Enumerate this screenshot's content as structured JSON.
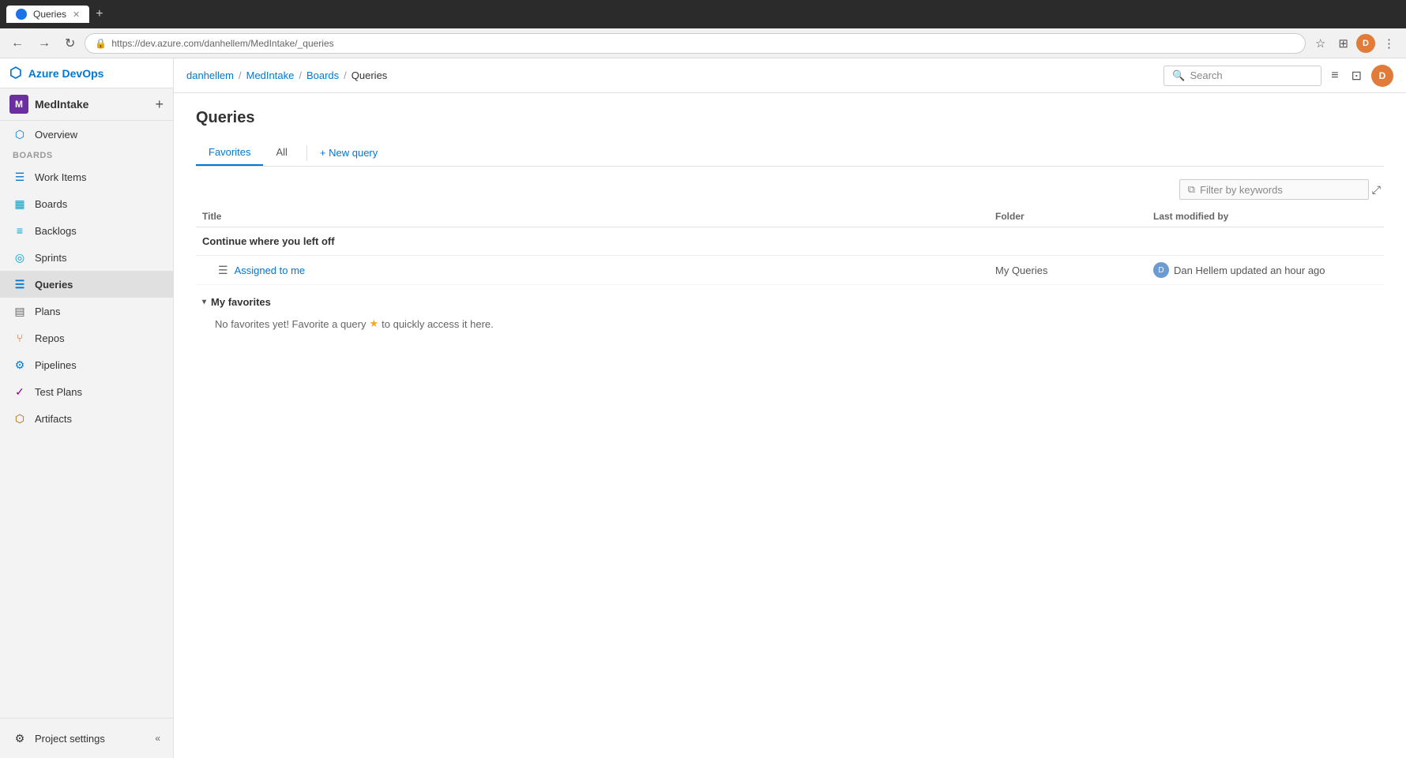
{
  "browser": {
    "tab_title": "Queries",
    "tab_favicon": "Q",
    "url": "https://dev.azure.com/danhellem/MedIntake/_queries",
    "back_btn": "←",
    "forward_btn": "→",
    "refresh_btn": "↻",
    "bookmark_icon": "☆",
    "profile_initial": "D",
    "extensions_icon": "⊞",
    "menu_icon": "⋮"
  },
  "topbar": {
    "breadcrumb": [
      {
        "label": "danhellem",
        "href": "#"
      },
      {
        "label": "MedIntake",
        "href": "#"
      },
      {
        "label": "Boards",
        "href": "#"
      },
      {
        "label": "Queries",
        "href": "#",
        "current": true
      }
    ],
    "search_placeholder": "Search",
    "settings_icon": "≡",
    "marketplace_icon": "⊡",
    "user_initial": "D"
  },
  "app_header": {
    "logo_icon": "◈",
    "logo_text": "Azure DevOps"
  },
  "project": {
    "avatar_initial": "M",
    "name": "MedIntake",
    "add_icon": "+"
  },
  "sidebar": {
    "nav_items": [
      {
        "id": "overview",
        "label": "Overview",
        "icon": "⬡"
      },
      {
        "id": "boards",
        "label": "Boards",
        "icon": "▦"
      },
      {
        "id": "work-items",
        "label": "Work Items",
        "icon": "☰"
      },
      {
        "id": "boards-sub",
        "label": "Boards",
        "icon": "▦"
      },
      {
        "id": "backlogs",
        "label": "Backlogs",
        "icon": "≡"
      },
      {
        "id": "sprints",
        "label": "Sprints",
        "icon": "◎"
      },
      {
        "id": "queries",
        "label": "Queries",
        "icon": "☰",
        "active": true
      },
      {
        "id": "plans",
        "label": "Plans",
        "icon": "▤"
      },
      {
        "id": "repos",
        "label": "Repos",
        "icon": "⑂"
      },
      {
        "id": "pipelines",
        "label": "Pipelines",
        "icon": "⚙"
      },
      {
        "id": "test-plans",
        "label": "Test Plans",
        "icon": "✓"
      },
      {
        "id": "artifacts",
        "label": "Artifacts",
        "icon": "⬡"
      }
    ],
    "footer": {
      "settings_label": "Project settings",
      "collapse_icon": "«"
    }
  },
  "page": {
    "title": "Queries",
    "tabs": [
      {
        "id": "favorites",
        "label": "Favorites",
        "active": true
      },
      {
        "id": "all",
        "label": "All",
        "active": false
      }
    ],
    "new_query_label": "+ New query",
    "filter_placeholder": "Filter by keywords",
    "filter_icon": "⧉",
    "expand_icon": "⤢",
    "columns": [
      {
        "id": "title",
        "label": "Title"
      },
      {
        "id": "folder",
        "label": "Folder"
      },
      {
        "id": "modified",
        "label": "Last modified by"
      }
    ],
    "continue_section": {
      "title": "Continue where you left off",
      "items": [
        {
          "icon": "☰",
          "name": "Assigned to me",
          "folder": "My Queries",
          "modifier_initial": "D",
          "modified_text": "Dan Hellem updated an hour ago"
        }
      ]
    },
    "favorites_section": {
      "title": "My favorites",
      "toggle_icon": "▾",
      "empty_text": "No favorites yet! Favorite a query",
      "star_icon": "★",
      "empty_text2": "to quickly access it here."
    }
  }
}
